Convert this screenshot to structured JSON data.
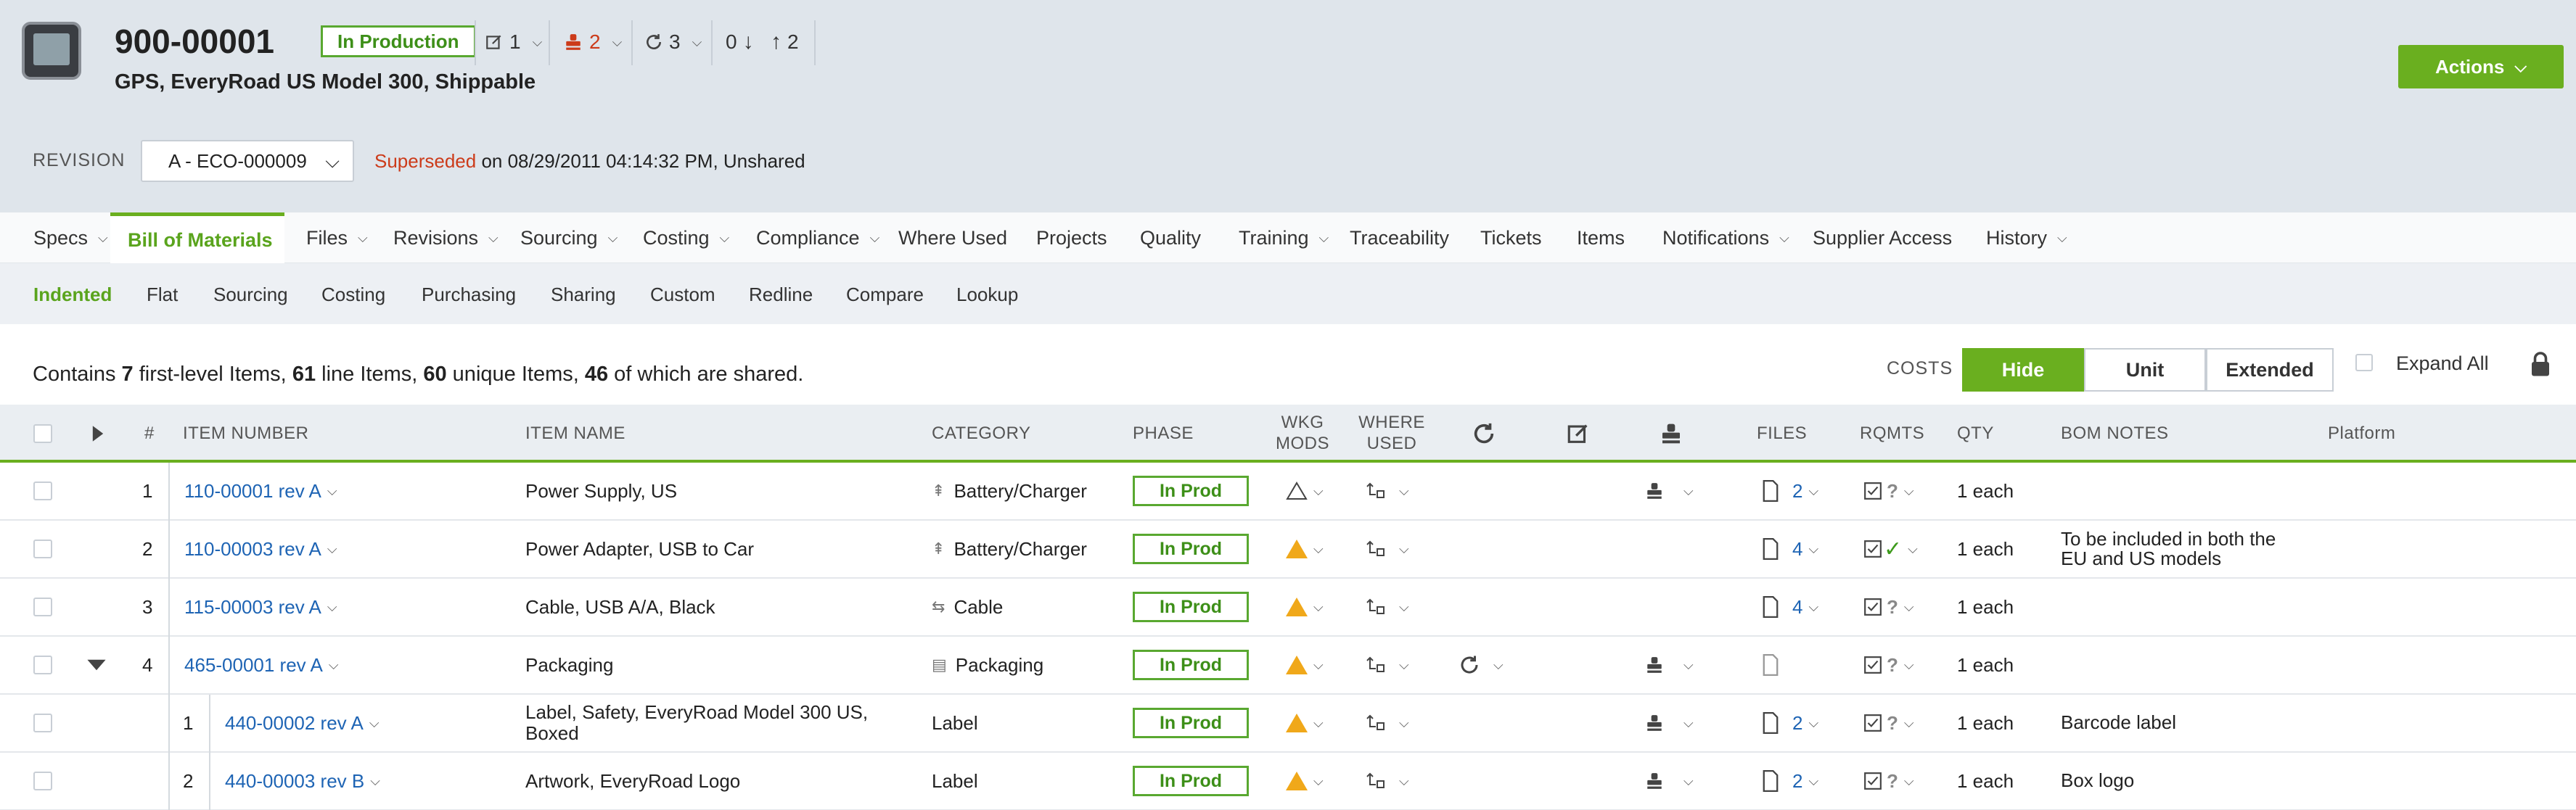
{
  "header": {
    "item_number": "900-00001",
    "status": "In Production",
    "title": "GPS, EveryRoad US Model 300, Shippable",
    "stat_changes": "1",
    "stat_approvals": "2",
    "stat_revisions": "3",
    "stat_down": "0",
    "stat_up": "2",
    "actions_label": "Actions"
  },
  "revision": {
    "label": "REVISION",
    "selected": "A - ECO-000009",
    "superseded_word": "Superseded",
    "superseded_rest": " on 08/29/2011 04:14:32 PM, Unshared"
  },
  "tabs": [
    "Specs",
    "Bill of Materials",
    "Files",
    "Revisions",
    "Sourcing",
    "Costing",
    "Compliance",
    "Where Used",
    "Projects",
    "Quality",
    "Training",
    "Traceability",
    "Tickets",
    "Items",
    "Notifications",
    "Supplier Access",
    "History"
  ],
  "subtabs": [
    "Indented",
    "Flat",
    "Sourcing",
    "Costing",
    "Purchasing",
    "Sharing",
    "Custom",
    "Redline",
    "Compare",
    "Lookup"
  ],
  "summary": {
    "p1": "Contains ",
    "n1": "7",
    "p2": " first-level Items, ",
    "n2": "61",
    "p3": " line Items, ",
    "n3": "60",
    "p4": " unique Items, ",
    "n4": "46",
    "p5": " of which are shared."
  },
  "costs": {
    "label": "COSTS",
    "hide": "Hide",
    "unit": "Unit",
    "extended": "Extended",
    "expand_all": "Expand All"
  },
  "columns": {
    "num": "#",
    "item_number": "ITEM NUMBER",
    "item_name": "ITEM NAME",
    "category": "CATEGORY",
    "phase": "PHASE",
    "wkg_mods_1": "WKG",
    "wkg_mods_2": "MODS",
    "where_used_1": "WHERE",
    "where_used_2": "USED",
    "files": "FILES",
    "rqmts": "RQMTS",
    "qty": "QTY",
    "bom_notes": "BOM NOTES",
    "platform": "Platform"
  },
  "rows": [
    {
      "num": "1",
      "item": "110-00001 rev A",
      "name": "Power Supply, US",
      "name2": "",
      "category": "Battery/Charger",
      "phase": "In Prod",
      "files": "2",
      "qty": "1 each",
      "notes": "",
      "notes2": ""
    },
    {
      "num": "2",
      "item": "110-00003 rev A",
      "name": "Power Adapter, USB to Car",
      "name2": "",
      "category": "Battery/Charger",
      "phase": "In Prod",
      "files": "4",
      "qty": "1 each",
      "notes": "To be included in both the",
      "notes2": "EU and US models"
    },
    {
      "num": "3",
      "item": "115-00003 rev A",
      "name": "Cable, USB A/A, Black",
      "name2": "",
      "category": "Cable",
      "phase": "In Prod",
      "files": "4",
      "qty": "1 each",
      "notes": "",
      "notes2": ""
    },
    {
      "num": "4",
      "item": "465-00001 rev A",
      "name": "Packaging",
      "name2": "",
      "category": "Packaging",
      "phase": "In Prod",
      "files": "",
      "qty": "1 each",
      "notes": "",
      "notes2": ""
    },
    {
      "num": "1",
      "item": "440-00002 rev A",
      "name": "Label, Safety, EveryRoad Model 300 US,",
      "name2": "Boxed",
      "category": "Label",
      "phase": "In Prod",
      "files": "2",
      "qty": "1 each",
      "notes": "Barcode label",
      "notes2": ""
    },
    {
      "num": "2",
      "item": "440-00003 rev B",
      "name": "Artwork, EveryRoad Logo",
      "name2": "",
      "category": "Label",
      "phase": "In Prod",
      "files": "2",
      "qty": "1 each",
      "notes": "Box logo",
      "notes2": ""
    }
  ],
  "colors": {
    "accent": "#6aaf1f",
    "link": "#1e64b4",
    "warning": "#f0a81a",
    "superseded": "#cc3b1a"
  }
}
